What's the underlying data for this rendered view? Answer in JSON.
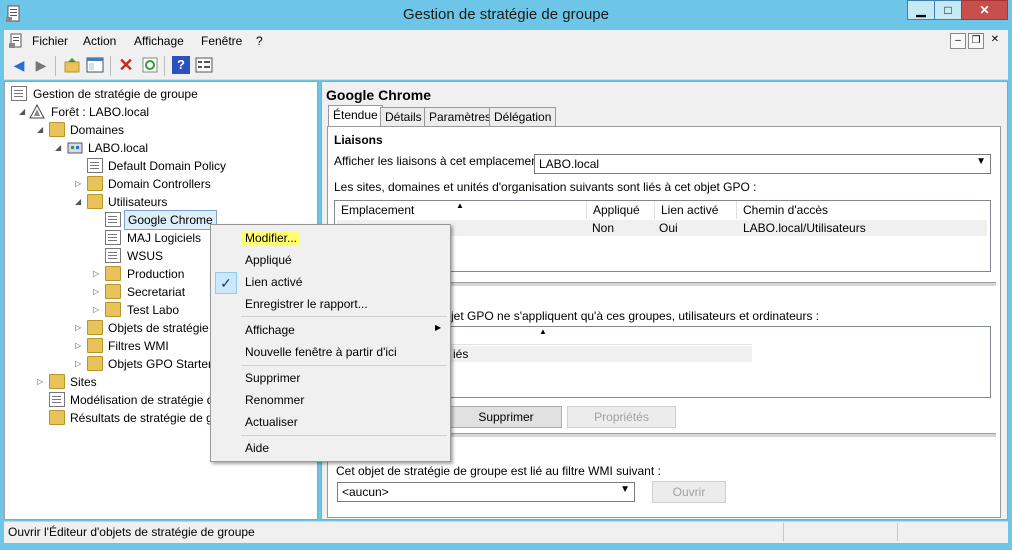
{
  "window": {
    "title": "Gestion de stratégie de groupe",
    "min": "▁",
    "max": "□",
    "close": "✕"
  },
  "menu": {
    "items": [
      "Fichier",
      "Action",
      "Affichage",
      "Fenêtre",
      "?"
    ]
  },
  "mdi": {
    "min": "–",
    "restore": "❐",
    "close": "✕"
  },
  "tree": {
    "root": "Gestion de stratégie de groupe",
    "forest": "Forêt : LABO.local",
    "domains": "Domaines",
    "domain": "LABO.local",
    "default_policy": "Default Domain Policy",
    "dc": "Domain Controllers",
    "users": "Utilisateurs",
    "gc": "Google Chrome",
    "maj": "MAJ Logiciels",
    "wsus": "WSUS",
    "production": "Production",
    "secretariat": "Secretariat",
    "test_labo": "Test Labo",
    "objets": "Objets de stratégie",
    "wmi": "Filtres WMI",
    "starter": "Objets GPO Starter",
    "sites": "Sites",
    "modelisation": "Modélisation de stratégie d",
    "resultats": "Résultats de stratégie de gr"
  },
  "right": {
    "title": "Google Chrome",
    "tabs": [
      "Étendue",
      "Détails",
      "Paramètres",
      "Délégation"
    ],
    "links_heading": "Liaisons",
    "show_links_label": "Afficher les liaisons à cet emplacement :",
    "location_value": "LABO.local",
    "sites_text": "Les sites, domaines et unités d'organisation suivants sont liés à cet objet GPO :",
    "table_headers": [
      "Emplacement",
      "Appliqué",
      "Lien activé",
      "Chemin d'accès"
    ],
    "table_row": {
      "applied": "Non",
      "enabled": "Oui",
      "path": "LABO.local/Utilisateurs"
    },
    "filter_text": "jet GPO ne s'appliquent qu'à ces groupes, utilisateurs et ordinateurs :",
    "filter_item": "iés",
    "delete_btn": "Supprimer",
    "props_btn": "Propriétés",
    "wmi_text": "Cet objet de stratégie de groupe est lié au filtre WMI suivant :",
    "wmi_value": "<aucun>",
    "open_btn": "Ouvrir"
  },
  "context_menu": {
    "modifier": "Modifier...",
    "applique": "Appliqué",
    "lien_active": "Lien activé",
    "enregistrer": "Enregistrer le rapport...",
    "affichage": "Affichage",
    "nouvelle_fenetre": "Nouvelle fenêtre à partir d'ici",
    "supprimer": "Supprimer",
    "renommer": "Renommer",
    "actualiser": "Actualiser",
    "aide": "Aide",
    "check": "✓"
  },
  "status": {
    "text": "Ouvrir l'Éditeur d'objets de stratégie de groupe"
  },
  "colors": {
    "titlebar": "#6dc6e7",
    "highlight": "#ffff6e",
    "close": "#c7504f"
  }
}
